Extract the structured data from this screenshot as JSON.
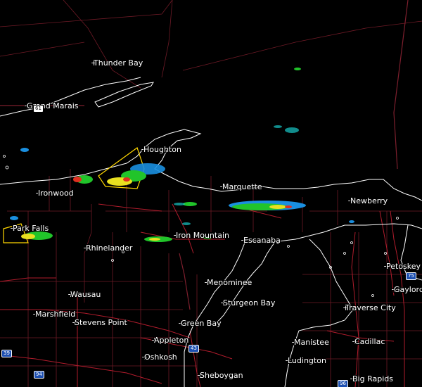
{
  "colors": {
    "background": "#000000",
    "land_boundary": "#ffffff",
    "county_lines": "#7a1e2a",
    "state_lines": "#8b2030",
    "roads": "#b51c2e",
    "warning_polygon": "#ffd700"
  },
  "cities": [
    {
      "name": "Thunder Bay"
    },
    {
      "name": "Grand Marais"
    },
    {
      "name": "Houghton"
    },
    {
      "name": "Ironwood"
    },
    {
      "name": "Marquette"
    },
    {
      "name": "Newberry"
    },
    {
      "name": "Park Falls"
    },
    {
      "name": "Iron Mountain"
    },
    {
      "name": "Escanaba"
    },
    {
      "name": "Rhinelander"
    },
    {
      "name": "Petoskey"
    },
    {
      "name": "Menominee"
    },
    {
      "name": "Gaylord"
    },
    {
      "name": "Wausau"
    },
    {
      "name": "Sturgeon Bay"
    },
    {
      "name": "Traverse City"
    },
    {
      "name": "Marshfield"
    },
    {
      "name": "Stevens Point"
    },
    {
      "name": "Green Bay"
    },
    {
      "name": "Appleton"
    },
    {
      "name": "Manistee"
    },
    {
      "name": "Cadillac"
    },
    {
      "name": "Oshkosh"
    },
    {
      "name": "Ludington"
    },
    {
      "name": "Sheboygan"
    },
    {
      "name": "Big Rapids"
    }
  ],
  "shields": [
    {
      "label": "61",
      "kind": "us"
    },
    {
      "label": "75",
      "kind": "interstate"
    },
    {
      "label": "43",
      "kind": "interstate"
    },
    {
      "label": "39",
      "kind": "interstate"
    },
    {
      "label": "94",
      "kind": "interstate"
    },
    {
      "label": "96",
      "kind": "interstate"
    }
  ]
}
